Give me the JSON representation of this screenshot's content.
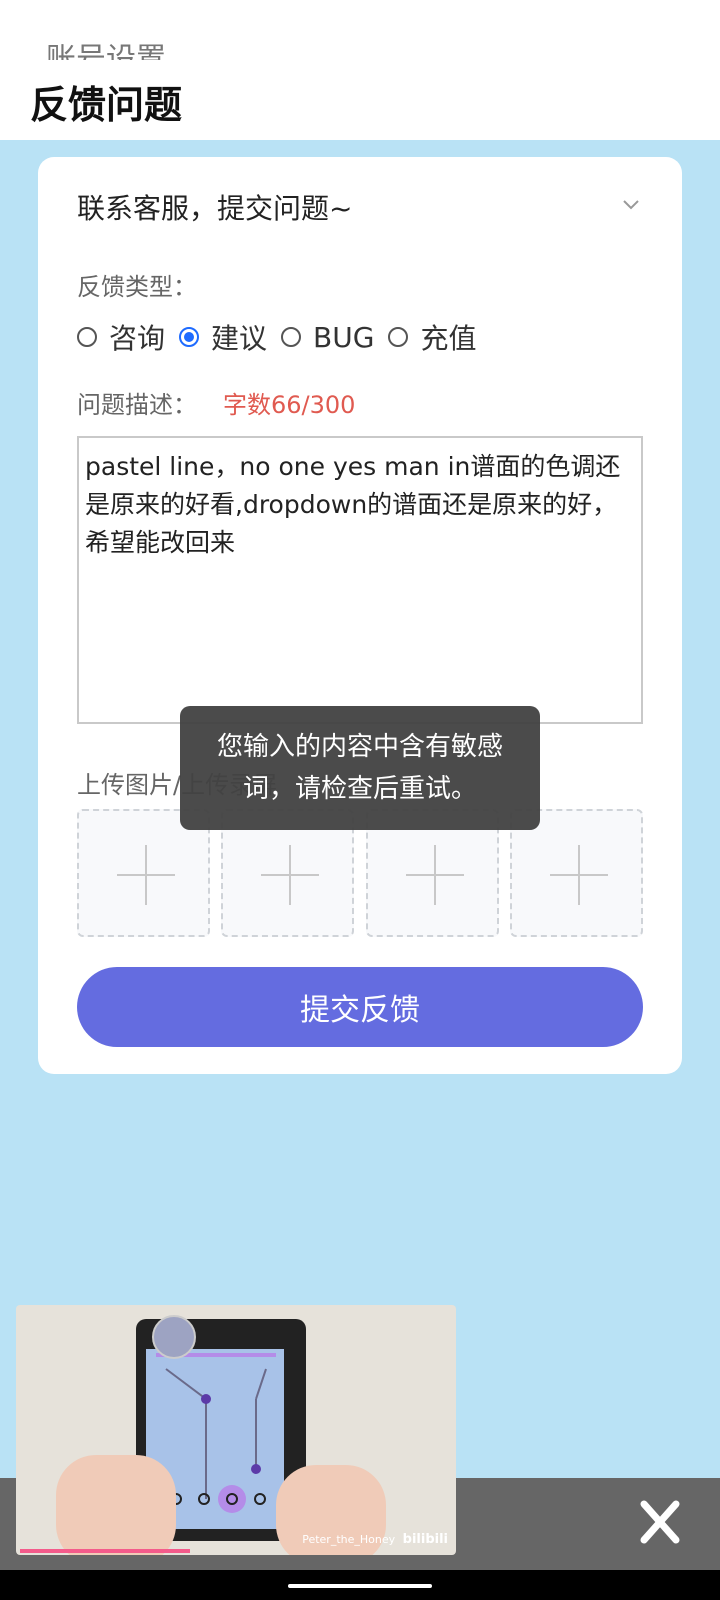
{
  "header": {
    "previous_title": "账号设置",
    "title": "反馈问题"
  },
  "contact": {
    "label": "联系客服，提交问题~"
  },
  "feedback_type": {
    "label": "反馈类型：",
    "options": [
      "咨询",
      "建议",
      "BUG",
      "充值"
    ],
    "selected": "建议"
  },
  "description": {
    "label": "问题描述：",
    "count": "字数66/300",
    "value": "pastel line，no one yes man in谱面的色调还是原来的好看,dropdown的谱面还是原来的好，希望能改回来"
  },
  "upload": {
    "label": "上传图片/上传录屏",
    "slots": 4
  },
  "submit": {
    "label": "提交反馈"
  },
  "toast": {
    "message": "您输入的内容中含有敏感词，请检查后重试。"
  },
  "mini_player": {
    "watermark": "Peter_the_Honey",
    "brand": "bilibili",
    "progress_fraction": 0.39
  },
  "colors": {
    "background": "#b9e2f5",
    "accent": "#646ce0",
    "radio_selected": "#1e6bff",
    "count_text": "#e05a50",
    "progress": "#f45b8b"
  }
}
